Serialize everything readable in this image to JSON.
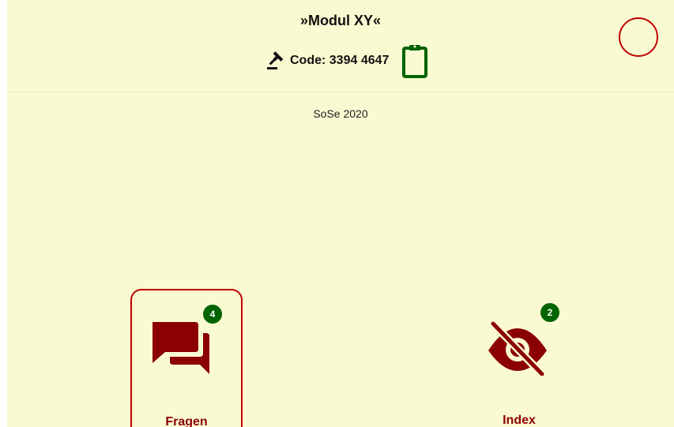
{
  "header": {
    "title": "»Modul XY«",
    "code_label": "Code: 3394 4647"
  },
  "icons": {
    "gavel": "gavel-icon",
    "clipboard": "clipboard-icon",
    "avatar": "avatar-circle",
    "fragen": "chat-bubbles-icon",
    "index": "eye-slash-icon"
  },
  "semester": "SoSe 2020",
  "tiles": [
    {
      "label": "Fragen",
      "badge": "4",
      "selected": true
    },
    {
      "label": "Index",
      "badge": "2",
      "selected": false
    }
  ],
  "colors": {
    "background": "#fafad2",
    "accent_red": "#8b0000",
    "border_red": "#c00000",
    "badge_green": "#006400",
    "clipboard_green": "#006400"
  }
}
